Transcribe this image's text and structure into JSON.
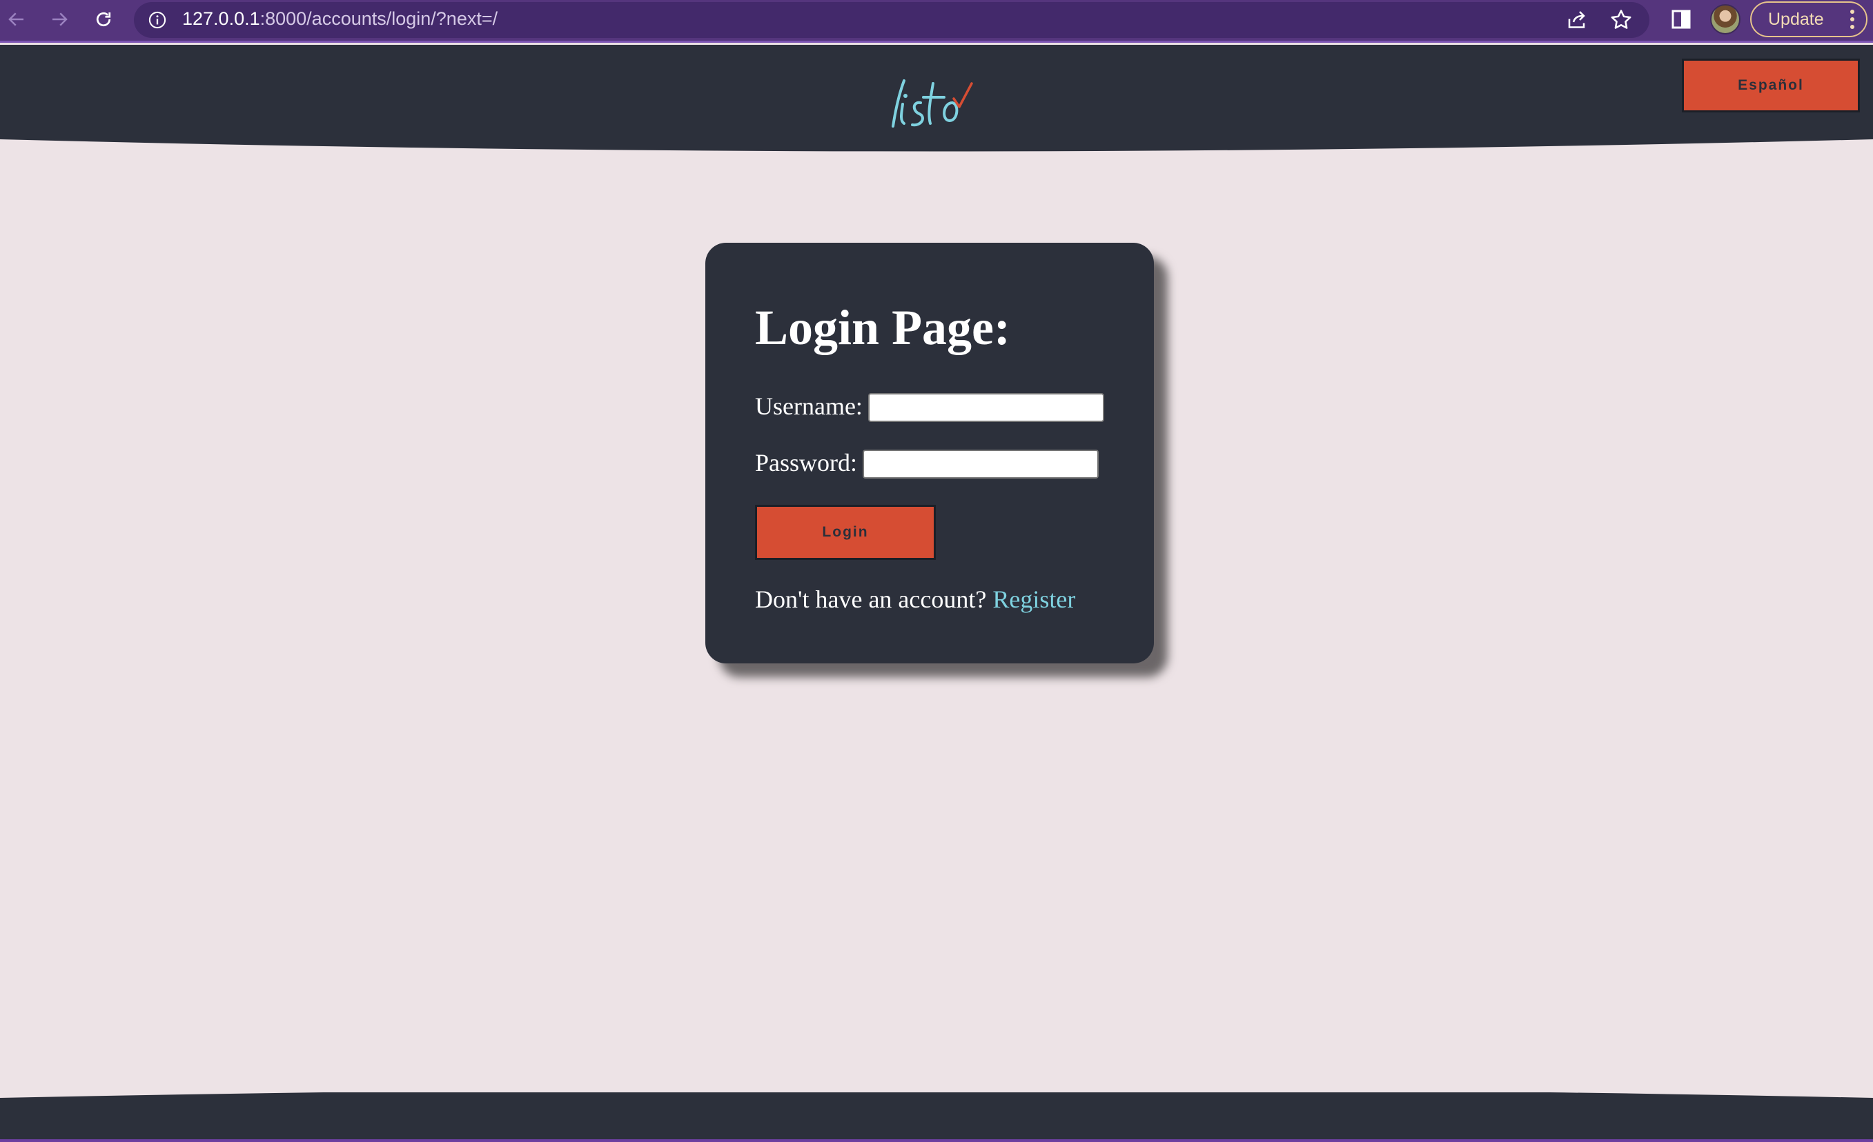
{
  "browser": {
    "url_host": "127.0.0.1",
    "url_rest": ":8000/accounts/login/?next=/",
    "update_label": "Update",
    "icons": [
      "back-icon",
      "forward-icon",
      "reload-icon",
      "info-icon",
      "share-icon",
      "star-icon",
      "side-panel-icon",
      "profile-avatar",
      "more-icon"
    ]
  },
  "header": {
    "logo_text": "listo",
    "language_button": "Español"
  },
  "login": {
    "title": "Login Page:",
    "username_label": "Username:",
    "username_value": "",
    "password_label": "Password:",
    "password_value": "",
    "submit_label": "Login",
    "account_prompt": "Don't have an account?",
    "register_link": "Register"
  },
  "colors": {
    "browser_bar": "#55357d",
    "header_bg": "#2c303b",
    "page_bg": "#ede3e6",
    "accent_button": "#d64d33",
    "link": "#7fd2e0",
    "logo_teal": "#7fd2e0",
    "logo_check": "#d64d33"
  }
}
